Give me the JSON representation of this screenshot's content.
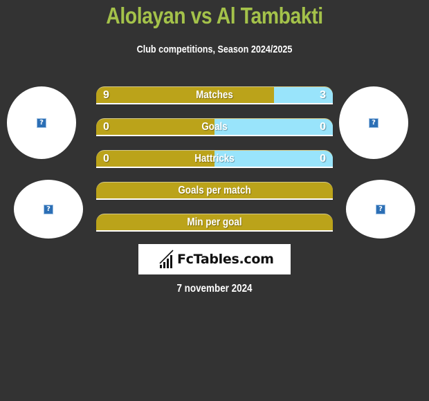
{
  "header": {
    "title": "Alolayan vs Al Tambakti",
    "subtitle": "Club competitions, Season 2024/2025"
  },
  "players": {
    "left": {
      "avatar_icon": "broken-image-icon",
      "avatar_glyph": "?",
      "club_icon": "broken-image-icon",
      "club_glyph": "?"
    },
    "right": {
      "avatar_icon": "broken-image-icon",
      "avatar_glyph": "?",
      "club_icon": "broken-image-icon",
      "club_glyph": "?"
    }
  },
  "colors": {
    "title": "#a4c24a",
    "left_bar": "#bba31a",
    "right_bar": "#99e4fb",
    "background": "#333333"
  },
  "stats": [
    {
      "label": "Matches",
      "left": "9",
      "right": "3",
      "left_share": 0.75
    },
    {
      "label": "Goals",
      "left": "0",
      "right": "0",
      "left_share": 0.5
    },
    {
      "label": "Hattricks",
      "left": "0",
      "right": "0",
      "left_share": 0.5
    },
    {
      "label": "Goals per match",
      "left": "",
      "right": "",
      "left_share": 1.0
    },
    {
      "label": "Min per goal",
      "left": "",
      "right": "",
      "left_share": 1.0
    }
  ],
  "branding": {
    "logo_text": "FcTables.com",
    "logo_icon": "bar-chart-icon"
  },
  "footer": {
    "date": "7 november 2024"
  }
}
